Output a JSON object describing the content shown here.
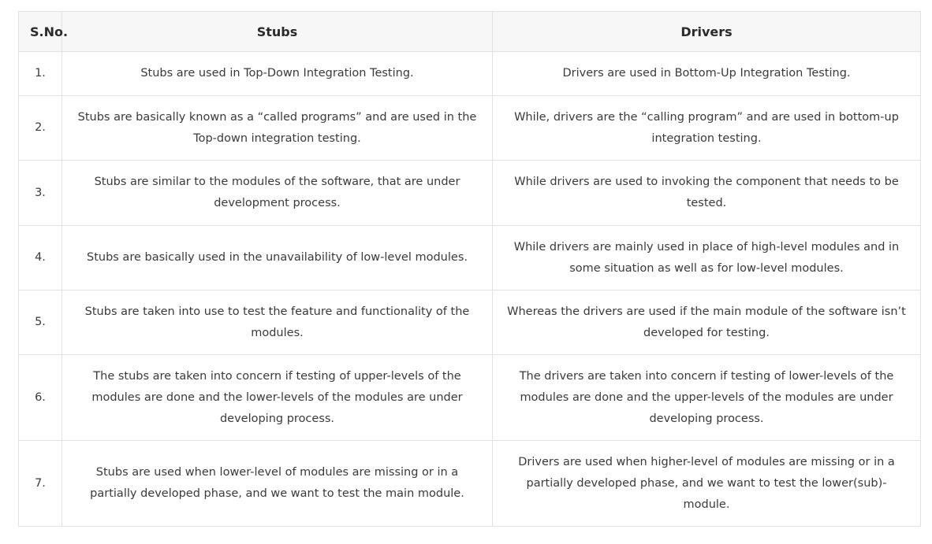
{
  "table": {
    "headers": [
      "S.No.",
      "Stubs",
      "Drivers"
    ],
    "rows": [
      {
        "num": "1.",
        "stubs": "Stubs are used in Top-Down Integration Testing.",
        "drivers": "Drivers are used in Bottom-Up Integration Testing."
      },
      {
        "num": "2.",
        "stubs": "Stubs are basically known as a “called programs” and are used in the Top-down integration testing.",
        "drivers": "While, drivers are the “calling program” and are used in bottom-up integration testing."
      },
      {
        "num": "3.",
        "stubs": "Stubs are similar to the modules of the software, that are under development process.",
        "drivers": "While drivers are used to invoking the component that needs to be tested."
      },
      {
        "num": "4.",
        "stubs": "Stubs are basically used in the unavailability of low-level modules.",
        "drivers": "While drivers are mainly used in place of high-level modules and in some situation as well as for low-level modules."
      },
      {
        "num": "5.",
        "stubs": "Stubs are taken into use to test the feature and functionality of the modules.",
        "drivers": "Whereas the drivers are used if the main module of the software isn’t developed for testing."
      },
      {
        "num": "6.",
        "stubs": "The stubs are taken into concern if testing of upper-levels of the modules are done and the lower-levels of the modules are under developing process.",
        "drivers": "The drivers are taken into concern if testing of lower-levels of the modules are done and the upper-levels of the modules are under developing process."
      },
      {
        "num": "7.",
        "stubs": "Stubs are used when lower-level of modules are missing or in a partially developed phase, and we want to test the main module.",
        "drivers": "Drivers are used when higher-level of modules are missing or in a partially developed phase, and we want to test the lower(sub)-module."
      }
    ]
  }
}
